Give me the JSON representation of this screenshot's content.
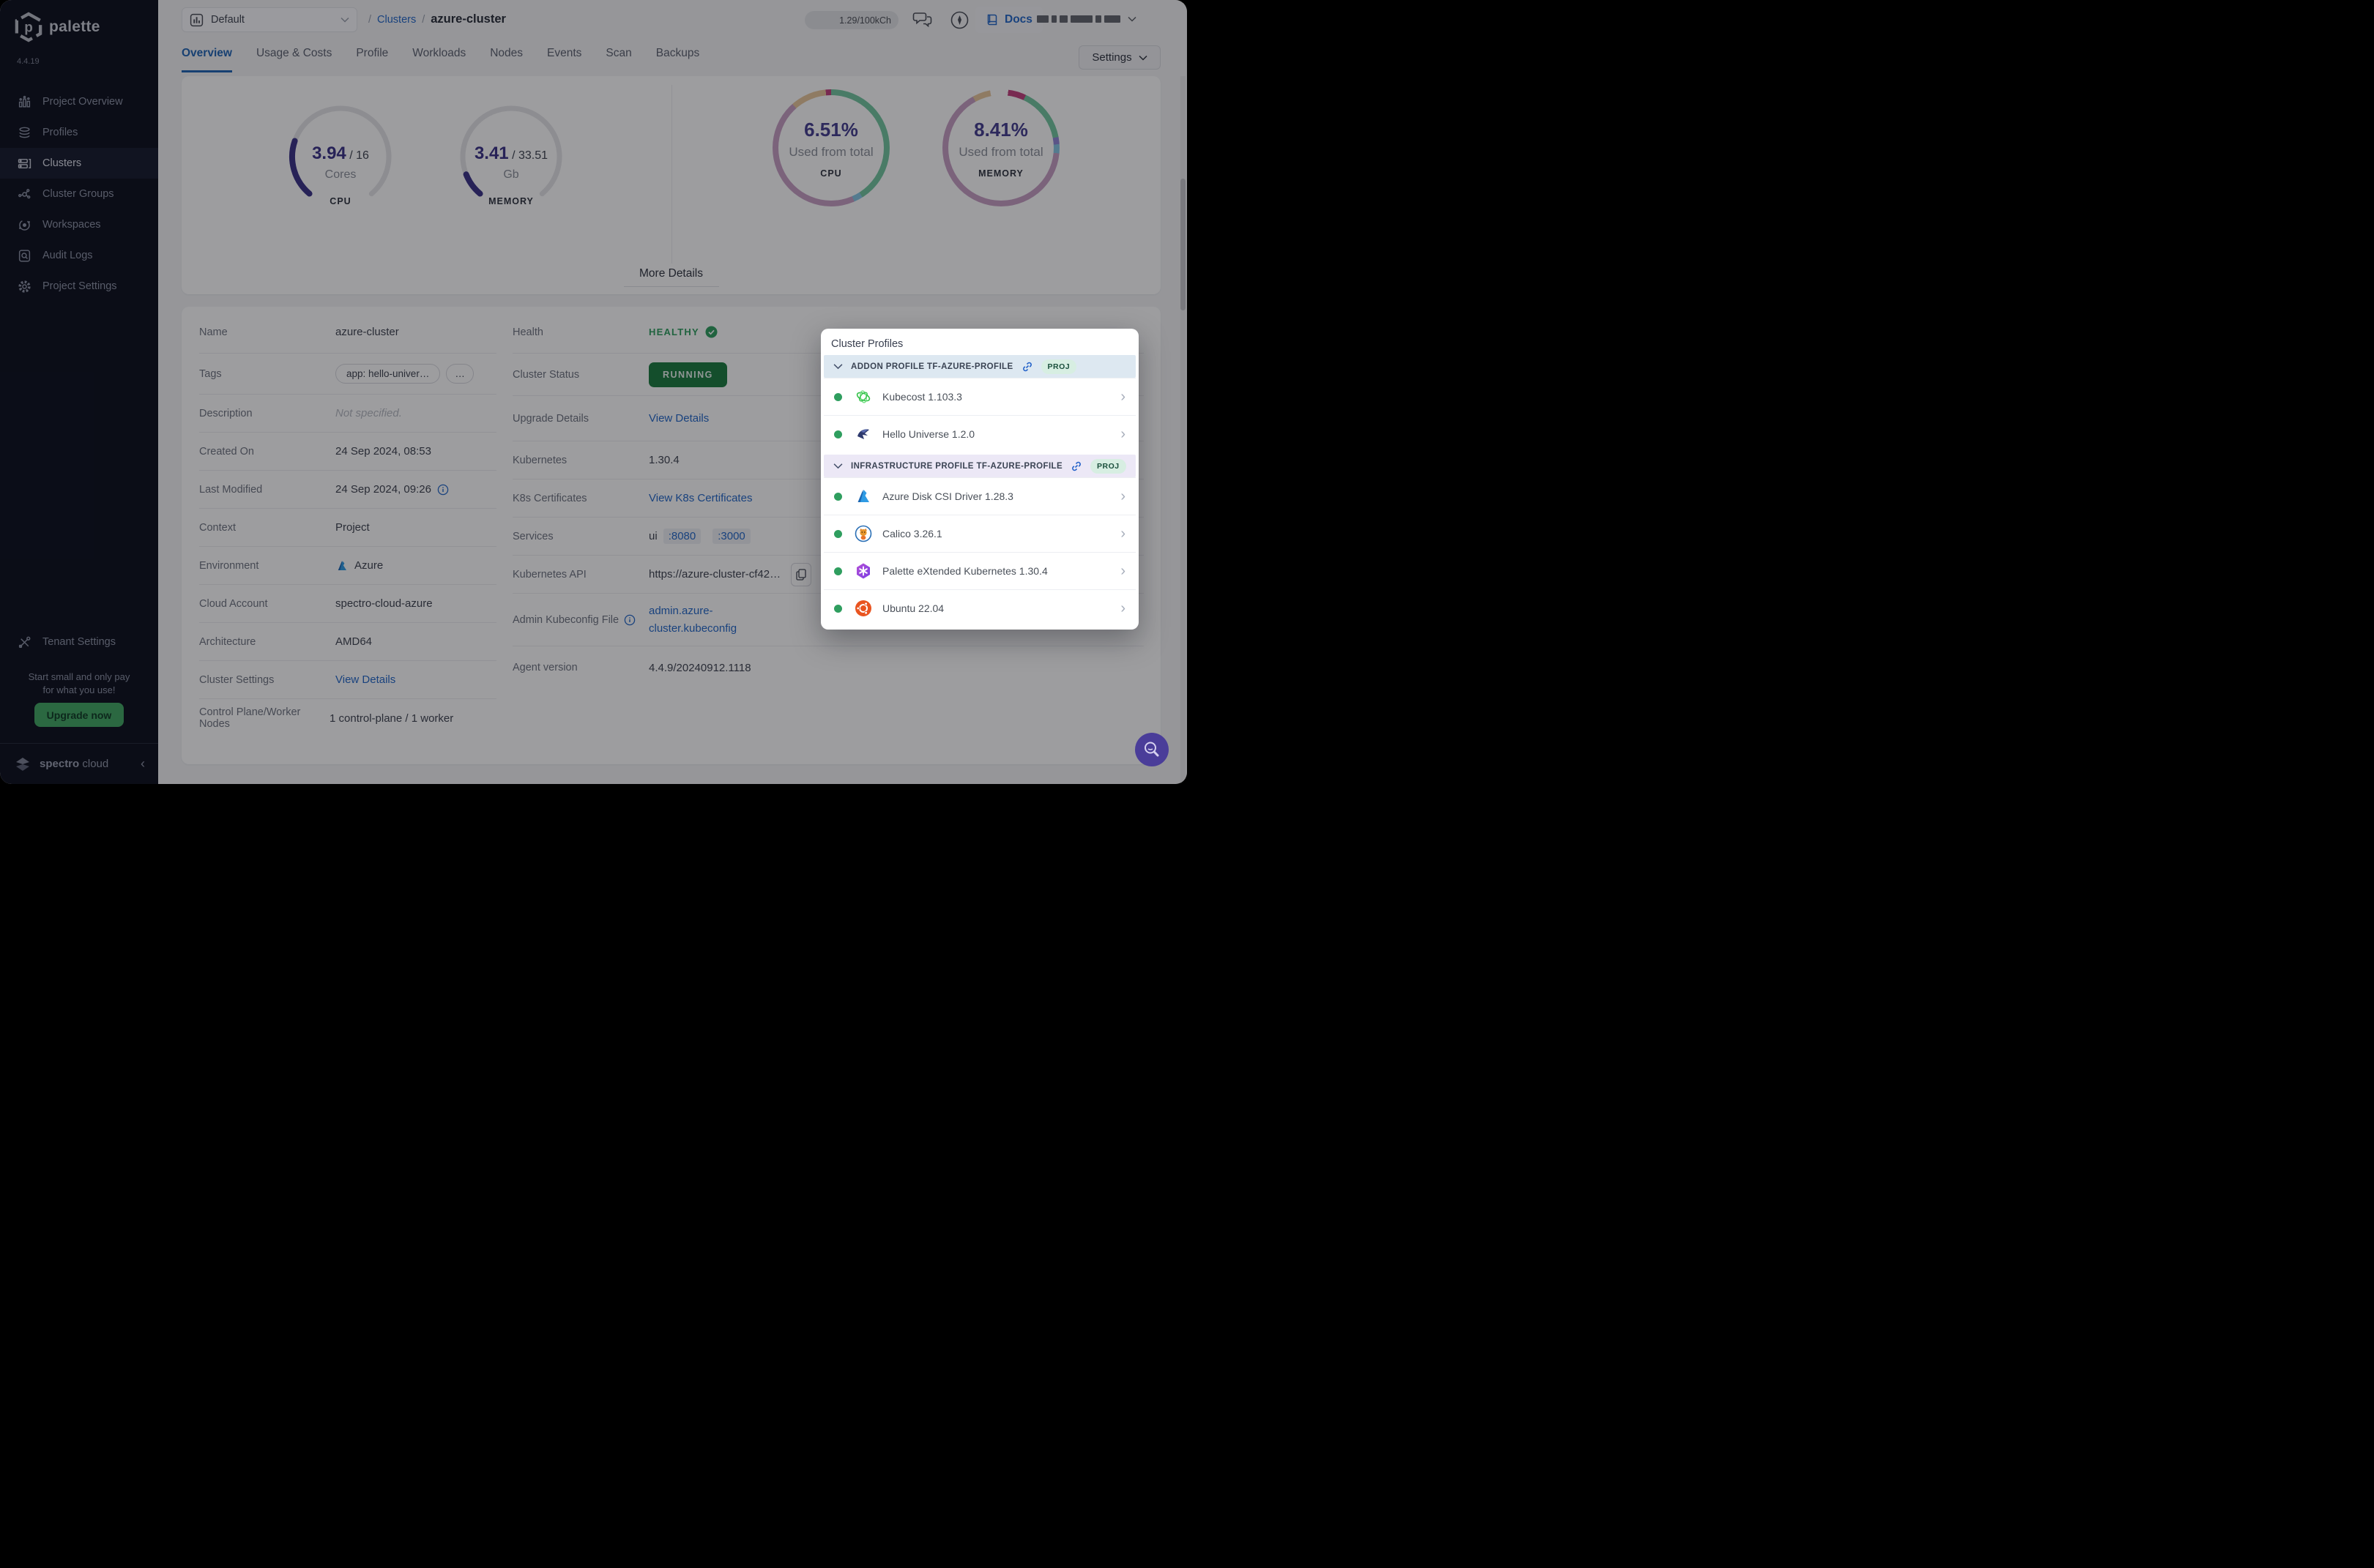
{
  "brand": {
    "name": "palette",
    "version": "4.4.19"
  },
  "sidebar": {
    "items": [
      {
        "label": "Project Overview"
      },
      {
        "label": "Profiles"
      },
      {
        "label": "Clusters"
      },
      {
        "label": "Cluster Groups"
      },
      {
        "label": "Workspaces"
      },
      {
        "label": "Audit Logs"
      },
      {
        "label": "Project Settings"
      }
    ],
    "active_item": "Clusters",
    "tenant_settings_label": "Tenant Settings",
    "promo_line1": "Start small and only pay",
    "promo_line2": "for what you use!",
    "upgrade_button": "Upgrade now",
    "footer_brand": "spectro",
    "footer_brand2": "cloud"
  },
  "topbar": {
    "project_selector": "Default",
    "breadcrumb_sep": "/",
    "breadcrumb_root": "Clusters",
    "breadcrumb_current": "azure-cluster",
    "credits": "1.29/100kCh",
    "docs_label": "Docs"
  },
  "tabs": {
    "items": [
      "Overview",
      "Usage & Costs",
      "Profile",
      "Workloads",
      "Nodes",
      "Events",
      "Scan",
      "Backups"
    ],
    "active": "Overview",
    "settings_button": "Settings"
  },
  "overview": {
    "more_details": "More Details"
  },
  "chart_data": [
    {
      "type": "gauge",
      "id": "cpu",
      "value": 3.94,
      "total": 16,
      "value_text": "3.94",
      "total_display": "/ 16",
      "unit": "Cores",
      "label": "CPU",
      "color": "#3b3387",
      "track": "#e4e4e8",
      "arc_degrees": 280
    },
    {
      "type": "gauge",
      "id": "memory",
      "value": 3.41,
      "total": 33.51,
      "value_text": "3.41",
      "total_display": "/ 33.51",
      "unit": "Gb",
      "label": "MEMORY",
      "color": "#3b3387",
      "track": "#e4e4e8",
      "arc_degrees": 280
    },
    {
      "type": "donut",
      "id": "cpu",
      "percent": 6.51,
      "percent_text": "6.51%",
      "caption": "Used from total",
      "label": "CPU",
      "segments": [
        {
          "color": "#74c6a0",
          "pct": 41
        },
        {
          "color": "#85c6e4",
          "pct": 2.5
        },
        {
          "color": "#c79fc4",
          "pct": 45
        },
        {
          "color": "#e8c79b",
          "pct": 10
        },
        {
          "color": "#c2407e",
          "pct": 1.5
        }
      ]
    },
    {
      "type": "donut",
      "id": "memory",
      "percent": 8.41,
      "percent_text": "8.41%",
      "caption": "Used from total",
      "label": "MEMORY",
      "segments": [
        {
          "color": "#ffffff",
          "pct": 2
        },
        {
          "color": "#c2407e",
          "pct": 5
        },
        {
          "color": "#74c6a0",
          "pct": 15
        },
        {
          "color": "#8f86d8",
          "pct": 2
        },
        {
          "color": "#85c6e4",
          "pct": 2.5
        },
        {
          "color": "#c79fc4",
          "pct": 65.5
        },
        {
          "color": "#e8c79b",
          "pct": 5
        },
        {
          "color": "#ffffff",
          "pct": 3
        }
      ]
    }
  ],
  "details": {
    "left": {
      "name": {
        "label": "Name",
        "value": "azure-cluster"
      },
      "tags": {
        "label": "Tags",
        "tag": "app: hello-univer…",
        "more": "…"
      },
      "description": {
        "label": "Description",
        "value": "Not specified."
      },
      "created": {
        "label": "Created On",
        "value": "24 Sep 2024, 08:53"
      },
      "modified": {
        "label": "Last Modified",
        "value": "24 Sep 2024, 09:26"
      },
      "context": {
        "label": "Context",
        "value": "Project"
      },
      "environment": {
        "label": "Environment",
        "value": "Azure"
      },
      "cloud_account": {
        "label": "Cloud Account",
        "value": "spectro-cloud-azure"
      },
      "architecture": {
        "label": "Architecture",
        "value": "AMD64"
      },
      "cluster_settings": {
        "label": "Cluster Settings",
        "link": "View Details"
      },
      "nodes": {
        "label": "Control Plane/Worker Nodes",
        "value": "1 control-plane / 1 worker"
      }
    },
    "right": {
      "health": {
        "label": "Health",
        "value": "HEALTHY"
      },
      "status": {
        "label": "Cluster Status",
        "value": "RUNNING"
      },
      "upgrade": {
        "label": "Upgrade Details",
        "link": "View Details"
      },
      "kubernetes": {
        "label": "Kubernetes",
        "value": "1.30.4"
      },
      "certificates": {
        "label": "K8s Certificates",
        "link": "View K8s Certificates"
      },
      "services": {
        "label": "Services",
        "name": "ui",
        "port1": ":8080",
        "port2": ":3000"
      },
      "api": {
        "label": "Kubernetes API",
        "value": "https://azure-cluster-cf42…"
      },
      "kubeconfig": {
        "label": "Admin Kubeconfig File",
        "link": "admin.azure-cluster.kubeconfig"
      },
      "agent": {
        "label": "Agent version",
        "value": "4.4.9/20240912.1118"
      }
    }
  },
  "cluster_profiles": {
    "title": "Cluster Profiles",
    "sections": [
      {
        "kind": "addon",
        "title": "ADDON PROFILE TF-AZURE-PROFILE",
        "badge": "PROJ",
        "items": [
          {
            "name": "Kubecost 1.103.3",
            "logo": "kubecost"
          },
          {
            "name": "Hello Universe 1.2.0",
            "logo": "hello-universe"
          }
        ]
      },
      {
        "kind": "infrastructure",
        "title": "INFRASTRUCTURE PROFILE TF-AZURE-PROFILE",
        "badge": "PROJ",
        "items": [
          {
            "name": "Azure Disk CSI Driver 1.28.3",
            "logo": "azure"
          },
          {
            "name": "Calico 3.26.1",
            "logo": "calico"
          },
          {
            "name": "Palette eXtended Kubernetes 1.30.4",
            "logo": "palette-pxk"
          },
          {
            "name": "Ubuntu 22.04",
            "logo": "ubuntu"
          }
        ]
      }
    ]
  }
}
